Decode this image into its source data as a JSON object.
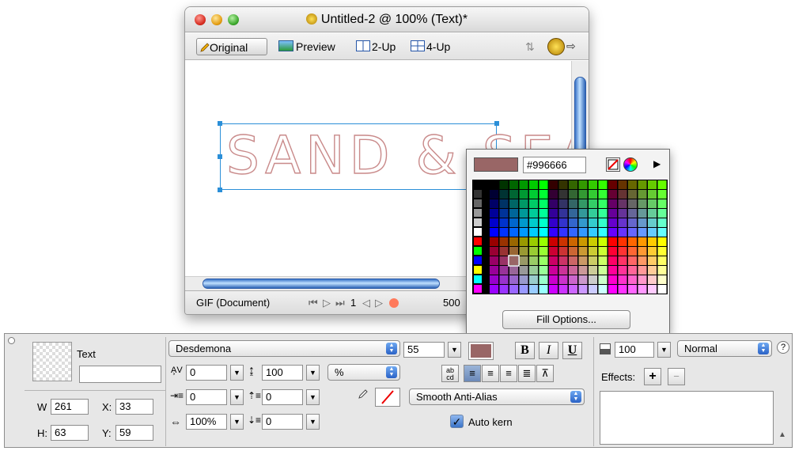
{
  "document": {
    "title": "Untitled-2 @ 100% (Text)*",
    "tabs": [
      "Original",
      "Preview",
      "2-Up",
      "4-Up"
    ],
    "artwork_text": "SAND & SEA",
    "status": {
      "format": "GIF (Document)",
      "frame": "1",
      "size": "500"
    }
  },
  "color_popup": {
    "hex": "#996666",
    "selected_color": "#996666",
    "fill_options_label": "Fill Options..."
  },
  "inspector": {
    "object_type": "Text",
    "object_name": "",
    "geometry": {
      "w_label": "W",
      "w": "261",
      "h_label": "H:",
      "h": "63",
      "x_label": "X:",
      "x": "33",
      "y_label": "Y:",
      "y": "59"
    },
    "font": "Desdemona",
    "font_size": "55",
    "text_color": "#996666",
    "kerning": "0",
    "leading": "100",
    "leading_unit": "%",
    "indent": "0",
    "space_before": "0",
    "horizontal_scale": "100%",
    "space_after": "0",
    "bold": "B",
    "italic": "I",
    "underline": "U",
    "anti_alias": "Smooth Anti-Alias",
    "auto_kern_label": "Auto kern",
    "auto_kern_checked": true,
    "opacity": "100",
    "blend_mode": "Normal",
    "effects_label": "Effects:",
    "effects_add": "+",
    "effects_remove": "−"
  }
}
